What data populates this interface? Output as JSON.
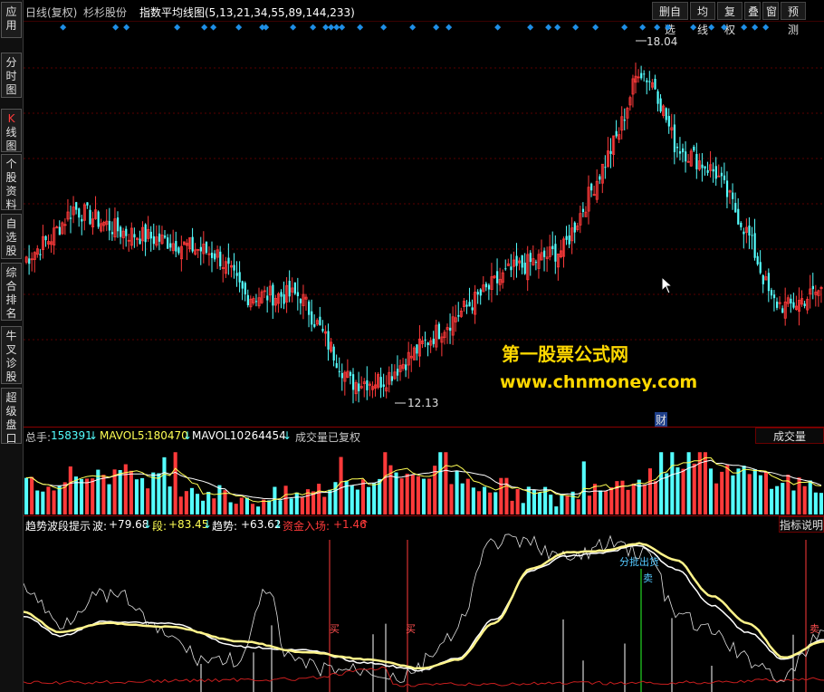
{
  "sidebar": {
    "tabs": [
      {
        "label": "应用",
        "name": "sidebar-tab-apps"
      },
      {
        "label": "分时图",
        "name": "sidebar-tab-intraday"
      },
      {
        "label": "K线图",
        "name": "sidebar-tab-kline"
      },
      {
        "label": "个股资料",
        "name": "sidebar-tab-stock-info"
      },
      {
        "label": "自选股",
        "name": "sidebar-tab-watchlist"
      },
      {
        "label": "综合排名",
        "name": "sidebar-tab-ranking"
      },
      {
        "label": "牛叉诊股",
        "name": "sidebar-tab-diagnosis"
      },
      {
        "label": "超级盘口",
        "name": "sidebar-tab-super-quote"
      }
    ]
  },
  "topbar": {
    "period": "日线(复权)",
    "stock_name": "杉杉股份",
    "indicator": "指数平均线图(5,13,21,34,55,89,144,233)",
    "buttons": [
      "删自选",
      "均线",
      "复权",
      "叠",
      "窗",
      "预测"
    ]
  },
  "price_chart": {
    "high_label": "18.04",
    "low_label": "12.13",
    "fin_marker": "财",
    "colors": {
      "up": "#ff3a3a",
      "down": "#54ffff",
      "grid": "#5a0000",
      "marker": "#1e8ee6"
    }
  },
  "volume": {
    "total_label": "总手:",
    "total_value": "158391",
    "ma5_label": "MAVOL5:",
    "ma5_value": "180470",
    "ma10_label": "MAVOL10:",
    "ma10_value": "264454",
    "note": "成交量已复权",
    "tab_label": "成交量",
    "arrow_down": "↓"
  },
  "indicator": {
    "name": "趋势波段提示",
    "wave_label": "波:",
    "wave_value": "+79.68",
    "band_label": "段:",
    "band_value": "+83.45",
    "trend_label": "趋势:",
    "trend_value": "+63.62",
    "fund_label": "资金入场:",
    "fund_value": "+1.46",
    "arrow_down": "↓",
    "arrow_up": "↑",
    "tab_label": "指标说明",
    "buy_label": "买",
    "sell_label": "卖",
    "batch_sell_label": "分批出货"
  },
  "watermark": {
    "line1": "第一股票公式网",
    "line2": "www.chnmoney.com"
  }
}
